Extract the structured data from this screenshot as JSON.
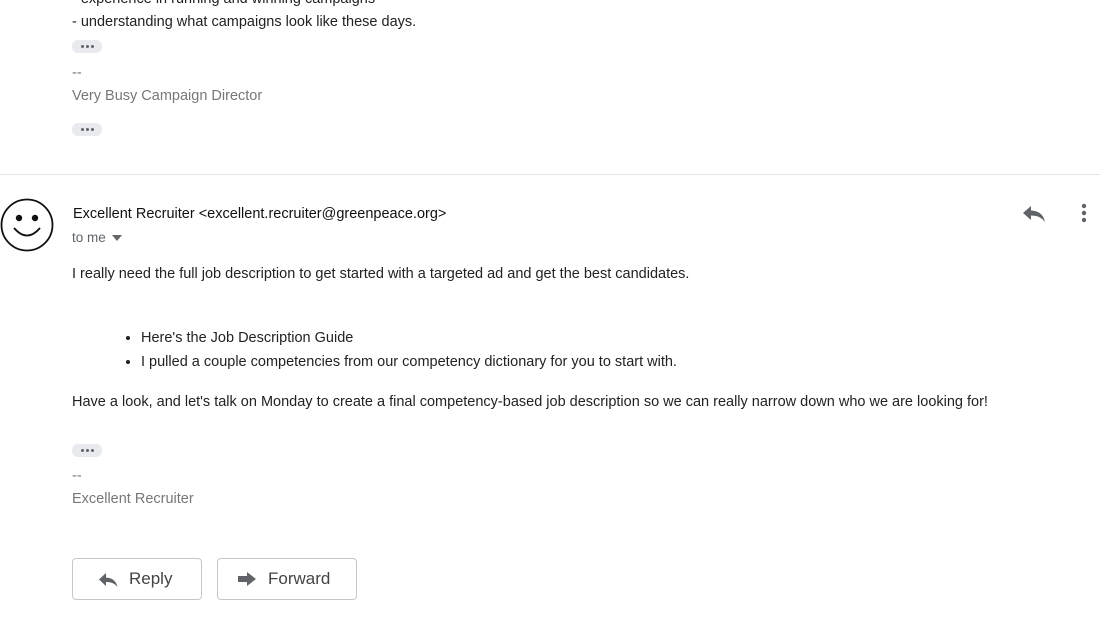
{
  "previous_message": {
    "line_cut": "- experience in running and winning campaigns",
    "line_2": "- understanding what campaigns look like these days.",
    "sig_separator": "--",
    "signature": "Very Busy Campaign Director"
  },
  "message": {
    "sender_name": "Excellent Recruiter",
    "sender_email": "<excellent.recruiter@greenpeace.org>",
    "recipients": "to me",
    "intro": "I really need the full job description to get started with a targeted ad and get the best candidates.",
    "bullets": [
      "Here's the Job Description Guide",
      "I pulled a couple competencies from our competency dictionary for you to start with."
    ],
    "closing": "Have a look, and let's talk on Monday to create a final competency-based job description so we can really narrow down who we are looking for!",
    "sig_separator": "--",
    "signature": "Excellent Recruiter"
  },
  "actions": {
    "reply_label": "Reply",
    "forward_label": "Forward"
  },
  "icons": {
    "avatar": "smiley-face-icon",
    "reply": "reply-arrow-icon",
    "more": "more-vertical-icon",
    "forward": "forward-arrow-icon",
    "recipients_toggle": "caret-down-icon",
    "trimmed_content": "ellipsis-icon"
  },
  "colors": {
    "text": "#222222",
    "muted": "#777777",
    "icon": "#5f6368",
    "border": "#c7c7c7"
  }
}
